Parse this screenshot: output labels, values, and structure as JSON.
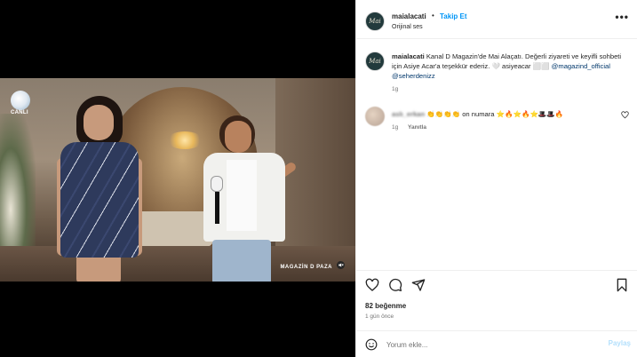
{
  "video": {
    "channel_logo_label": "CANLI",
    "watermark": "MAGAZİN D PAZA"
  },
  "header": {
    "username": "maialacati",
    "dot": "•",
    "follow_label": "Takip Et",
    "audio_label": "Orijinal ses",
    "avatar_text": "Mai"
  },
  "caption": {
    "username": "maialacati",
    "text": "Kanal D Magazin'de Mai Alaçatı. Değerli ziyareti ve keyifli sohbeti için Asiye Acar'a teşekkür ederiz. 🤍 asiyeacar ⬜⬜",
    "mention1": "@magazind_official",
    "mention2": "@seherdenizz",
    "time": "1g"
  },
  "comment": {
    "username": "aslı_erkan",
    "text": "👏👏👏👏 on numara ⭐🔥⭐🔥⭐🎩🎩🔥",
    "time": "1g",
    "reply_label": "Yanıtla"
  },
  "actions": {
    "likes": "82 beğenme",
    "ago": "1 gün önce",
    "comment_placeholder": "Yorum ekle...",
    "post_label": "Paylaş"
  },
  "colors": {
    "link_blue": "#0095f6",
    "mention_blue": "#00376b",
    "muted": "#737373"
  },
  "icons": [
    "heart-icon",
    "comment-icon",
    "share-icon",
    "bookmark-icon",
    "emoji-icon",
    "more-icon",
    "sound-off-icon"
  ]
}
